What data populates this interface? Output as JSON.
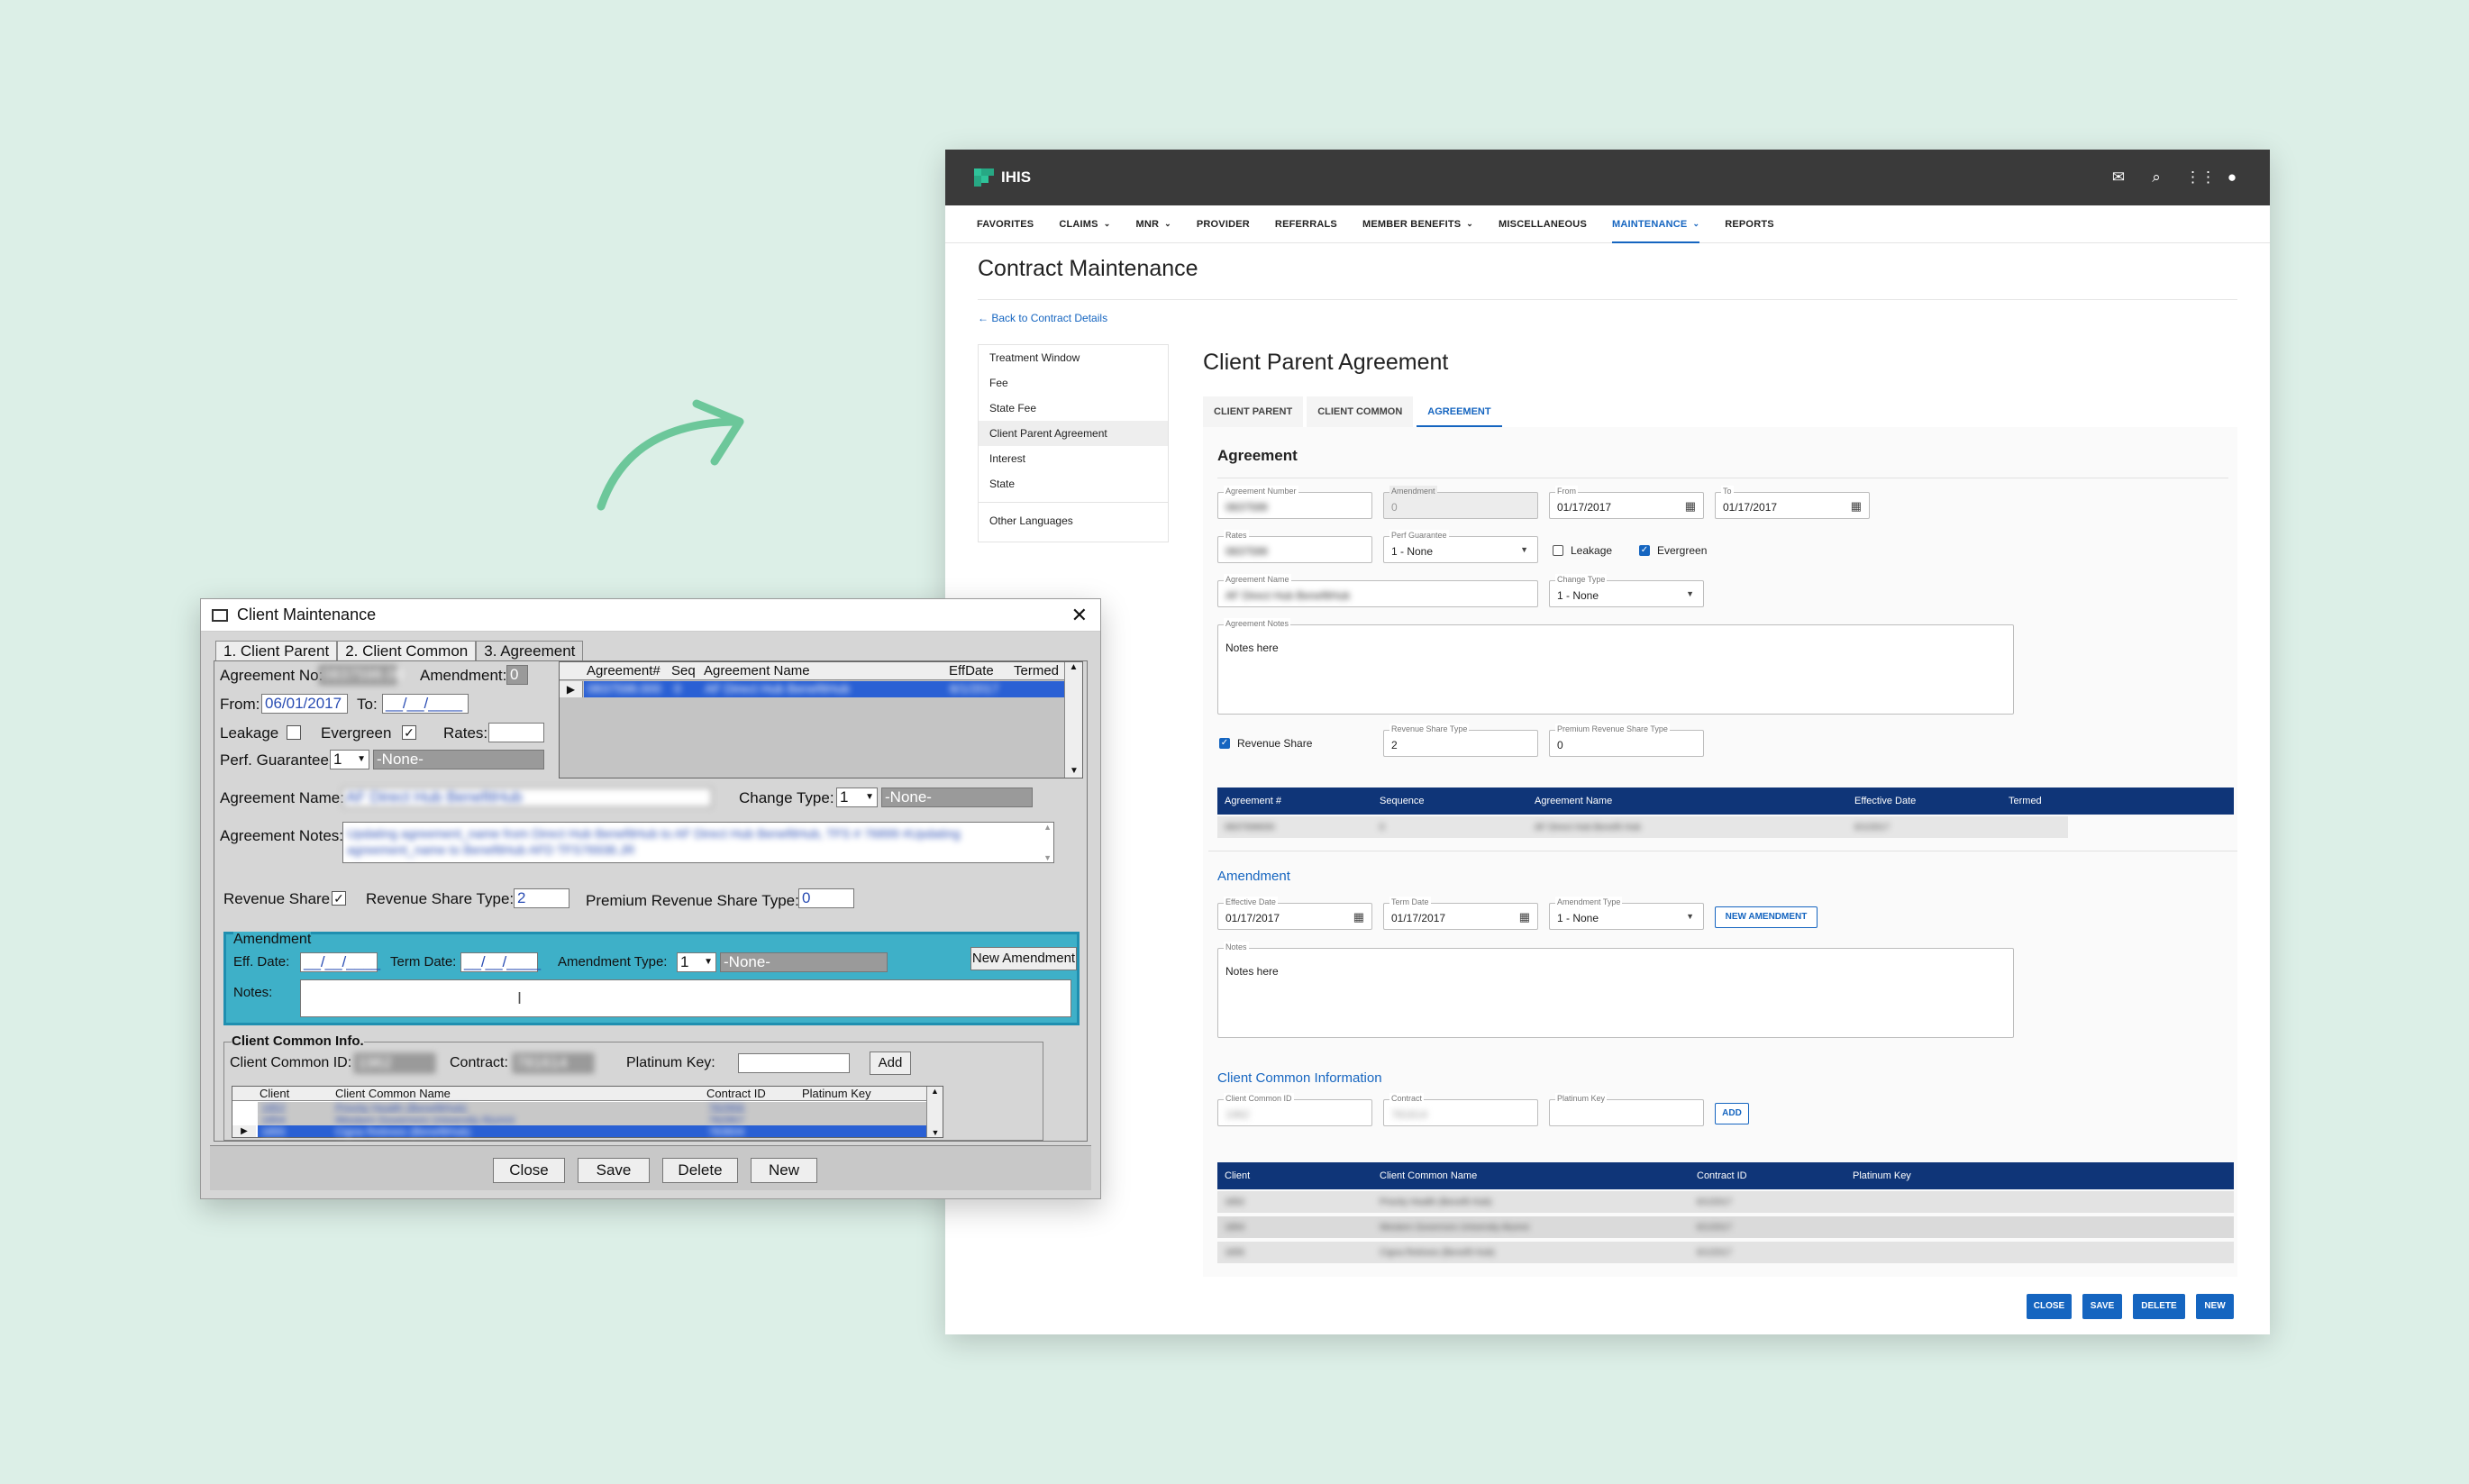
{
  "modern": {
    "brand": "IHIS",
    "topbar_icons": [
      "mail-icon",
      "search-icon",
      "apps-grid-icon",
      "user-icon"
    ],
    "nav": [
      {
        "label": "FAVORITES",
        "chevron": false,
        "active": false
      },
      {
        "label": "CLAIMS",
        "chevron": true,
        "active": false
      },
      {
        "label": "MNR",
        "chevron": true,
        "active": false
      },
      {
        "label": "PROVIDER",
        "chevron": false,
        "active": false
      },
      {
        "label": "REFERRALS",
        "chevron": false,
        "active": false
      },
      {
        "label": "MEMBER BENEFITS",
        "chevron": true,
        "active": false
      },
      {
        "label": "MISCELLANEOUS",
        "chevron": false,
        "active": false
      },
      {
        "label": "MAINTENANCE",
        "chevron": true,
        "active": true
      },
      {
        "label": "REPORTS",
        "chevron": false,
        "active": false
      }
    ],
    "page_title": "Contract Maintenance",
    "back_link": "Back to Contract Details",
    "side_nav": [
      "Treatment Window",
      "Fee",
      "State Fee",
      "Client Parent Agreement",
      "Interest",
      "State",
      "Other Languages"
    ],
    "section_title": "Client Parent Agreement",
    "tabs": [
      "CLIENT PARENT",
      "CLIENT COMMON",
      "AGREEMENT"
    ],
    "agreement": {
      "heading": "Agreement",
      "agreement_number_label": "Agreement Number",
      "agreement_number": "0837599",
      "amendment_label": "Amendment",
      "amendment": "0",
      "from_label": "From",
      "from": "01/17/2017",
      "to_label": "To",
      "to": "01/17/2017",
      "rates_label": "Rates",
      "rates": "0837599",
      "perf_guarantee_label": "Perf Guarantee",
      "perf_guarantee": "1 - None",
      "leakage_label": "Leakage",
      "evergreen_label": "Evergreen",
      "agreement_name_label": "Agreement Name",
      "agreement_name": "AF Direct Hub BenefitHub",
      "change_type_label": "Change Type",
      "change_type": "1 - None",
      "notes_label": "Agreement Notes",
      "notes": "Notes here",
      "revenue_share_label": "Revenue Share",
      "revenue_share_type_label": "Revenue Share Type",
      "revenue_share_type": "2",
      "premium_revenue_share_type_label": "Premium Revenue Share Type",
      "premium_revenue_share_type": "0",
      "table_headers": [
        "Agreement #",
        "Sequence",
        "Agreement Name",
        "Effective Date",
        "Termed"
      ],
      "table_row": [
        "0837599000",
        "0",
        "AF Direct Hub Benefit Hub",
        "6/1/2017",
        ""
      ]
    },
    "amendment": {
      "heading": "Amendment",
      "effective_date_label": "Effective Date",
      "effective_date": "01/17/2017",
      "term_date_label": "Term Date",
      "term_date": "01/17/2017",
      "amendment_type_label": "Amendment Type",
      "amendment_type": "1 - None",
      "new_amendment_button": "NEW AMENDMENT",
      "notes_label": "Notes",
      "notes": "Notes here"
    },
    "client_common": {
      "heading": "Client Common Information",
      "client_common_id_label": "Client Common ID",
      "client_common_id": "1962",
      "contract_label": "Contract",
      "contract": "781614",
      "platinum_key_label": "Platinum Key",
      "add_button": "ADD",
      "table_headers": [
        "Client",
        "Client Common Name",
        "Contract ID",
        "Platinum Key"
      ],
      "rows": [
        [
          "1852",
          "Priority Health (Benefit Hub)",
          "6/1/2017",
          ""
        ],
        [
          "1854",
          "Western Governors University Alumni",
          "6/1/2017",
          ""
        ],
        [
          "1855",
          "Cigna Retirees (Benefit Hub)",
          "6/1/2017",
          ""
        ]
      ]
    },
    "footer_buttons": [
      "CLOSE",
      "SAVE",
      "DELETE",
      "NEW"
    ]
  },
  "legacy": {
    "title": "Client Maintenance",
    "tabs": [
      "1. Client Parent",
      "2. Client Common",
      "3. Agreement"
    ],
    "agreement_no_label": "Agreement No:",
    "agreement_no": "0837598.00",
    "amendment_label": "Amendment:",
    "amendment": "0",
    "from_label": "From:",
    "from": "06/01/2017",
    "to_label": "To:",
    "to": "__/__/____",
    "leakage_label": "Leakage",
    "evergreen_label": "Evergreen",
    "evergreen_mark": "✓",
    "rates_label": "Rates:",
    "perf_guarantee_label": "Perf. Guarantee:",
    "perf_guarantee": "1",
    "perf_guarantee_desc": "-None-",
    "grid_headers": [
      "Agreement#",
      "Seq",
      "Agreement Name",
      "EffDate",
      "Termed"
    ],
    "grid_row": [
      "0837598.000",
      "0",
      "AF Direct Hub BenefitHub",
      "6/1/2017",
      ""
    ],
    "agreement_name_label": "Agreement Name:",
    "agreement_name": "AF Direct Hub BenefitHub",
    "change_type_label": "Change Type:",
    "change_type": "1",
    "change_type_desc": "-None-",
    "agreement_notes_label": "Agreement Notes:",
    "agreement_notes": "Updating agreement_name from Direct Hub BenefitHub to AF Direct Hub BenefitHub, TFS # 76899 #Updating agreement_name to BenefitHub AFD TFS76938.JR",
    "revenue_share_label": "Revenue Share",
    "revenue_share_mark": "✓",
    "revenue_share_type_label": "Revenue Share Type:",
    "revenue_share_type": "2",
    "premium_revenue_share_type_label": "Premium Revenue Share Type:",
    "premium_revenue_share_type": "0",
    "amendment_group": "Amendment",
    "eff_date_label": "Eff. Date:",
    "eff_date": "__/__/____",
    "term_date_label": "Term Date:",
    "term_date": "__/__/____",
    "amendment_type_label": "Amendment Type:",
    "amendment_type": "1",
    "amendment_type_desc": "-None-",
    "new_amendment_button": "New Amendment",
    "notes_label": "Notes:",
    "client_common_group": "Client Common Info.",
    "client_common_id_label": "Client Common ID:",
    "client_common_id": "1962",
    "contract_label": "Contract:",
    "contract": "781614",
    "platinum_key_label": "Platinum Key:",
    "add_button": "Add",
    "cc_headers": [
      "Client",
      "Client Common Name",
      "Contract ID",
      "Platinum Key"
    ],
    "cc_rows": [
      [
        "1852",
        "Priority Health (BenefitHub)",
        "782956",
        ""
      ],
      [
        "1854",
        "Western Governors University Alumni",
        "782957",
        ""
      ],
      [
        "1855",
        "Cigna Retirees (BenefitHub)",
        "783604",
        ""
      ]
    ],
    "buttons": [
      "Close",
      "Save",
      "Delete",
      "New"
    ]
  },
  "colors": {
    "background": "#dcefe7",
    "accent": "#1565c0",
    "table_header": "#0f3578",
    "brand_green": "#2fc39a",
    "legacy_amend": "#3eb0c8",
    "arrow": "#6cc79a"
  }
}
